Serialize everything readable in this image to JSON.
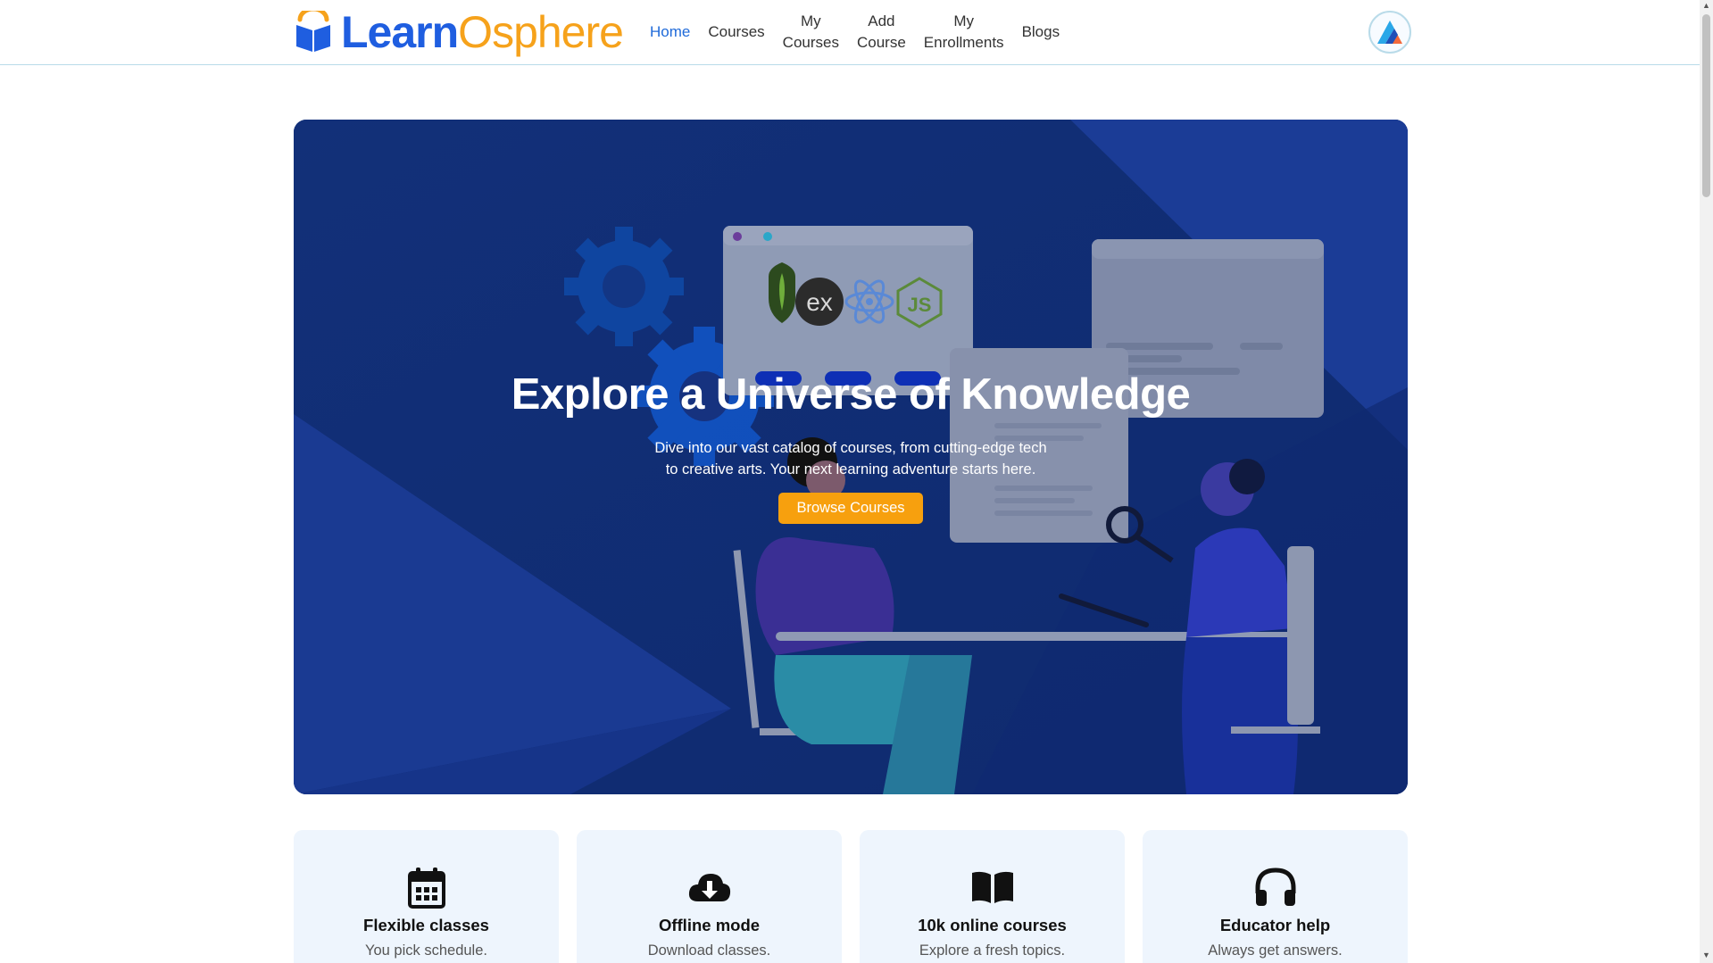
{
  "header": {
    "logo": {
      "learn": "Learn",
      "sphere": "Osphere"
    },
    "nav": [
      {
        "line1": "Home",
        "line2": ""
      },
      {
        "line1": "Courses",
        "line2": ""
      },
      {
        "line1": "My",
        "line2": "Courses"
      },
      {
        "line1": "Add",
        "line2": "Course"
      },
      {
        "line1": "My",
        "line2": "Enrollments"
      },
      {
        "line1": "Blogs",
        "line2": ""
      }
    ],
    "active_nav": "Home",
    "avatar_icon": "user-avatar-logo"
  },
  "hero": {
    "title": "Explore a Universe of Knowledge",
    "subtitle": "Dive into our vast catalog of courses, from cutting-edge tech to creative arts. Your next learning adventure starts here.",
    "button_label": "Browse Courses",
    "art_badges": [
      "ex",
      "JS"
    ],
    "colors": {
      "background": "#16327f",
      "accent": "#f7a00e"
    }
  },
  "features": [
    {
      "icon": "calendar-icon",
      "title": "Flexible classes",
      "desc": "You pick schedule."
    },
    {
      "icon": "cloud-download-icon",
      "title": "Offline mode",
      "desc": "Download classes."
    },
    {
      "icon": "book-open-icon",
      "title": "10k online courses",
      "desc": "Explore a fresh topics."
    },
    {
      "icon": "headphones-icon",
      "title": "Educator help",
      "desc": "Always get answers."
    }
  ]
}
